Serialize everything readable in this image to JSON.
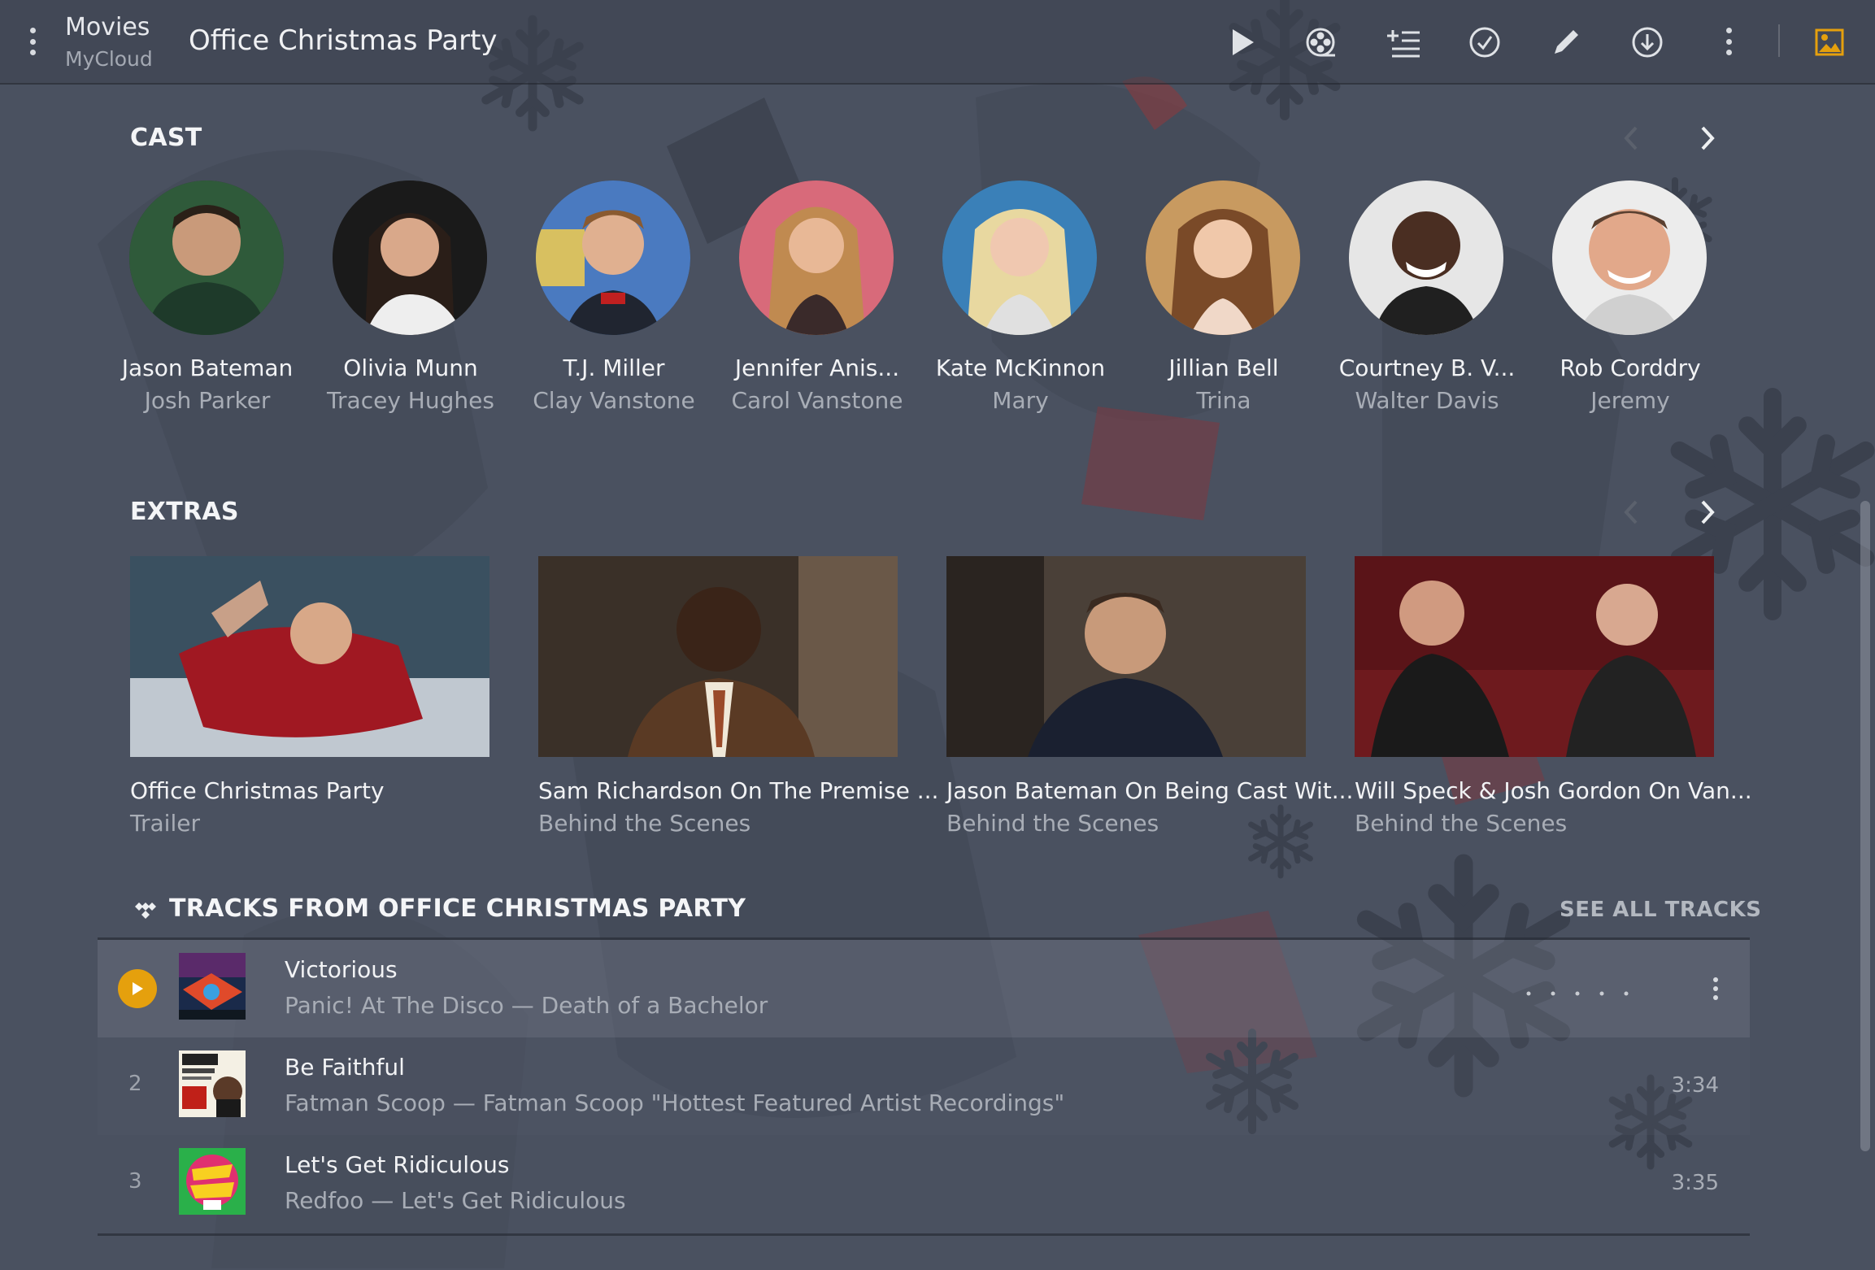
{
  "header": {
    "library_title": "Movies",
    "library_server": "MyCloud",
    "page_title": "Office Christmas Party"
  },
  "toolbar": {
    "icons": [
      "play-icon",
      "film-reel-icon",
      "add-to-queue-icon",
      "check-circle-icon",
      "edit-pencil-icon",
      "download-icon",
      "more-icon",
      "background-image-icon"
    ],
    "accent_color": "#e5a00d"
  },
  "cast": {
    "title": "CAST",
    "items": [
      {
        "name": "Jason Bateman",
        "role": "Josh Parker"
      },
      {
        "name": "Olivia Munn",
        "role": "Tracey Hughes"
      },
      {
        "name": "T.J. Miller",
        "role": "Clay Vanstone"
      },
      {
        "name": "Jennifer Anis...",
        "role": "Carol Vanstone"
      },
      {
        "name": "Kate McKinnon",
        "role": "Mary"
      },
      {
        "name": "Jillian Bell",
        "role": "Trina"
      },
      {
        "name": "Courtney B. V...",
        "role": "Walter Davis"
      },
      {
        "name": "Rob Corddry",
        "role": "Jeremy"
      }
    ]
  },
  "extras": {
    "title": "EXTRAS",
    "items": [
      {
        "title": "Office Christmas Party",
        "subtitle": "Trailer"
      },
      {
        "title": "Sam Richardson On The Premise ...",
        "subtitle": "Behind the Scenes"
      },
      {
        "title": "Jason Bateman On Being Cast Wit...",
        "subtitle": "Behind the Scenes"
      },
      {
        "title": "Will Speck & Josh Gordon On Van...",
        "subtitle": "Behind the Scenes"
      }
    ]
  },
  "tracks": {
    "title": "TRACKS FROM OFFICE CHRISTMAS PARTY",
    "see_all": "SEE ALL TRACKS",
    "items": [
      {
        "number": "",
        "title": "Victorious",
        "artist": "Panic! At The Disco",
        "album": "Death of a Bachelor",
        "separator": "—",
        "duration": "",
        "playing": true
      },
      {
        "number": "2",
        "title": "Be Faithful",
        "artist": "Fatman Scoop",
        "album": "Fatman Scoop \"Hottest Featured Artist Recordings\"",
        "separator": "—",
        "duration": "3:34",
        "playing": false
      },
      {
        "number": "3",
        "title": "Let's Get Ridiculous",
        "artist": "Redfoo",
        "album": "Let's Get Ridiculous",
        "separator": "—",
        "duration": "3:35",
        "playing": false
      }
    ]
  }
}
